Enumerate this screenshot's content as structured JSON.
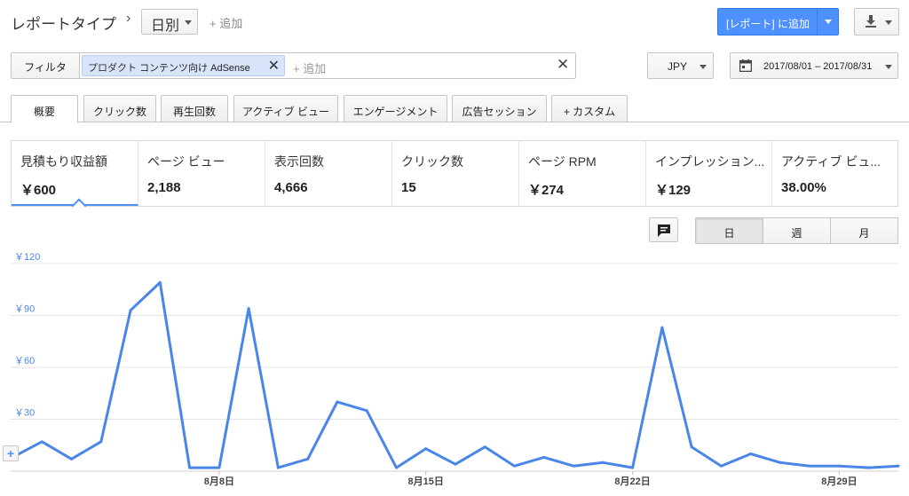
{
  "header": {
    "report_type": "レポートタイプ",
    "breadcrumb_sep": "›",
    "view": "日別",
    "add": "+ 追加",
    "add_to_report": "[レポート] に追加"
  },
  "filter": {
    "label": "フィルタ",
    "chip_prefix": "プロダクト",
    "chip_value": "コンテンツ向け AdSense",
    "add": "+ 追加",
    "clear": "✕"
  },
  "currency": "JPY",
  "date_range": "2017/08/01 – 2017/08/31",
  "tabs": [
    "概要",
    "クリック数",
    "再生回数",
    "アクティブ ビュー",
    "エンゲージメント",
    "広告セッション",
    "+ カスタム"
  ],
  "metrics": [
    {
      "name": "見積もり収益額",
      "value": "￥600"
    },
    {
      "name": "ページ ビュー",
      "value": "2,188"
    },
    {
      "name": "表示回数",
      "value": "4,666"
    },
    {
      "name": "クリック数",
      "value": "15"
    },
    {
      "name": "ページ RPM",
      "value": "￥274"
    },
    {
      "name": "インプレッション...",
      "value": "￥129"
    },
    {
      "name": "アクティブ ビュ...",
      "value": "38.00%"
    }
  ],
  "periods": [
    "日",
    "週",
    "月"
  ],
  "colors": {
    "accent": "#4d90fe",
    "line": "#4a86e8"
  },
  "icons": [
    "chevron-right-icon",
    "download-icon",
    "calendar-icon",
    "comment-icon",
    "close-icon",
    "zoom-plus-icon"
  ],
  "chart_data": {
    "type": "line",
    "x": [
      "8/1",
      "8/2",
      "8/3",
      "8/4",
      "8/5",
      "8/6",
      "8/7",
      "8/8",
      "8/9",
      "8/10",
      "8/11",
      "8/12",
      "8/13",
      "8/14",
      "8/15",
      "8/16",
      "8/17",
      "8/18",
      "8/19",
      "8/20",
      "8/21",
      "8/22",
      "8/23",
      "8/24",
      "8/25",
      "8/26",
      "8/27",
      "8/28",
      "8/29",
      "8/30",
      "8/31"
    ],
    "values": [
      8,
      17,
      7,
      17,
      93,
      109,
      2,
      2,
      94,
      2,
      7,
      40,
      35,
      2,
      13,
      4,
      14,
      3,
      8,
      3,
      5,
      2,
      83,
      14,
      3,
      10,
      5,
      3,
      3,
      2,
      3
    ],
    "yticks": [
      "￥30",
      "￥60",
      "￥90",
      "￥120"
    ],
    "ytick_values": [
      30,
      60,
      90,
      120
    ],
    "ylim": [
      0,
      120
    ],
    "xticks": [
      {
        "label": "8月8日",
        "index": 7
      },
      {
        "label": "8月15日",
        "index": 14
      },
      {
        "label": "8月22日",
        "index": 21
      },
      {
        "label": "8月29日",
        "index": 28
      }
    ],
    "grid": true
  }
}
